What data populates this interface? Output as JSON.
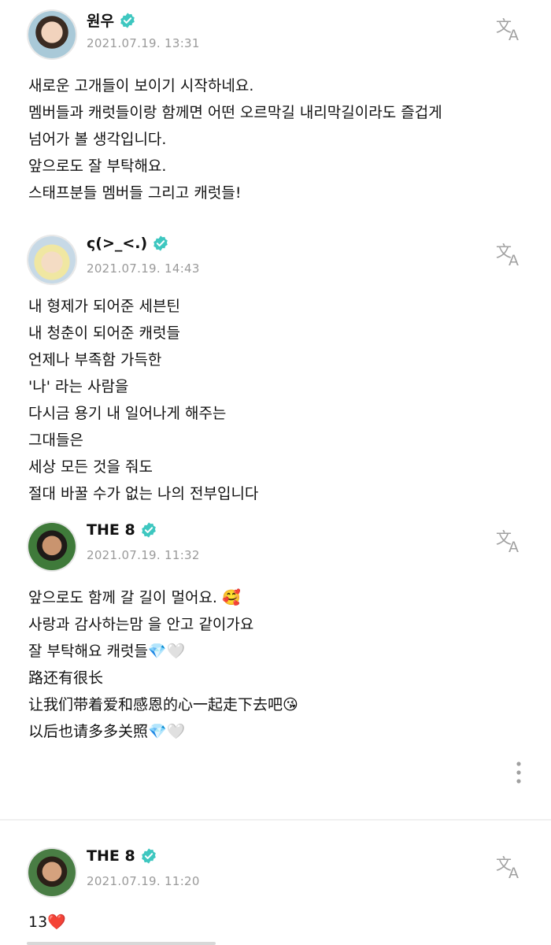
{
  "posts": [
    {
      "author": "원우",
      "date": "2021.07.19. 13:31",
      "lines": [
        "새로운 고개들이 보이기 시작하네요.",
        "멤버들과 캐럿들이랑 함께면 어떤 오르막길 내리막길이라도 즐겁게",
        "넘어가 볼 생각입니다.",
        "앞으로도 잘 부탁해요.",
        "스태프분들 멤버들 그리고 캐럿들!"
      ]
    },
    {
      "author": "ς(>_<.)",
      "date": "2021.07.19. 14:43",
      "lines": [
        "내 형제가 되어준 세븐틴",
        "내 청춘이 되어준 캐럿들",
        "언제나 부족함 가득한",
        "'나' 라는 사람을",
        "다시금 용기 내 일어나게 해주는",
        "그대들은",
        "세상 모든 것을 줘도",
        "절대 바꿀 수가 없는 나의 전부입니다"
      ]
    },
    {
      "author": "THE 8",
      "date": "2021.07.19. 11:32",
      "lines": [
        "앞으로도 함께 갈 길이 멀어요. 🥰",
        "사랑과 감사하는맘 을 안고 같이가요",
        "잘 부탁해요 캐럿들💎🤍",
        "路还有很长",
        "让我们带着爱和感恩的心一起走下去吧😘",
        "以后也请多多关照💎🤍"
      ]
    },
    {
      "author": "THE 8",
      "date": "2021.07.19. 11:20",
      "lines": [
        "13❤️"
      ]
    }
  ],
  "icons": {
    "verified": "verified-badge-icon",
    "translate": "translate-icon",
    "more": "more-options-icon"
  },
  "colors": {
    "verified": "#3ec7c0",
    "date": "#9a9a9a",
    "icon": "#a0a0a0"
  }
}
